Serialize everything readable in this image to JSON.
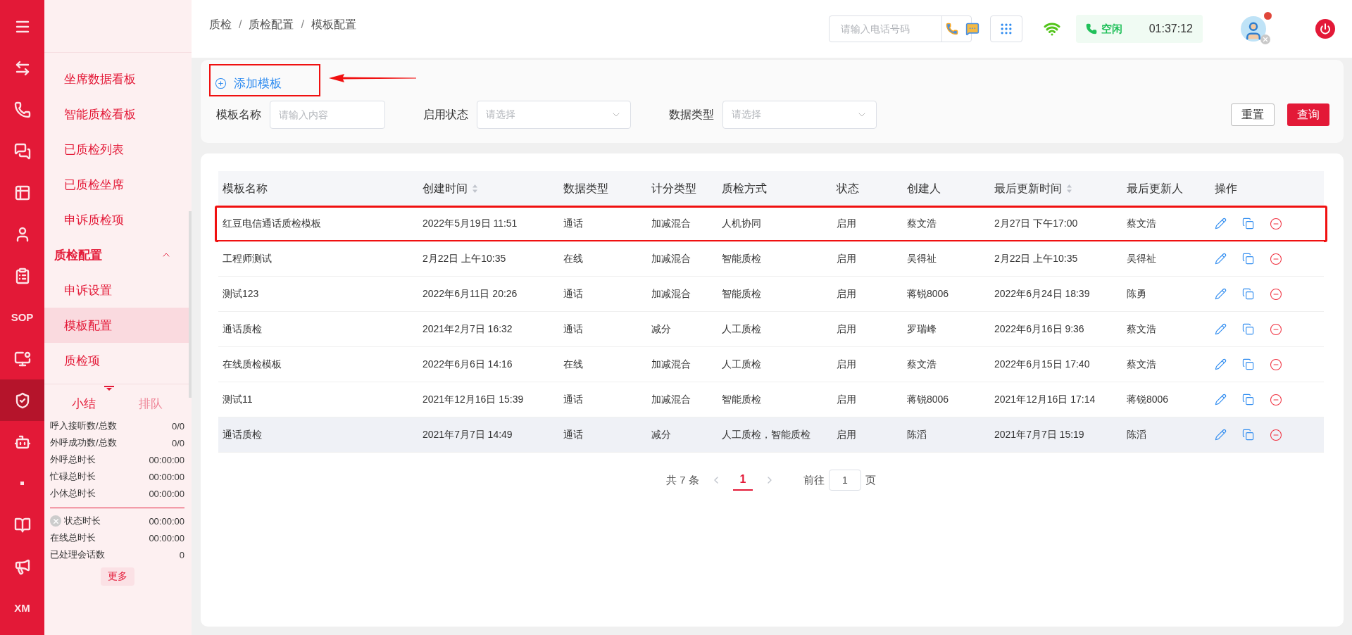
{
  "rail": [
    {
      "selected": false
    },
    {
      "selected": false
    },
    {
      "selected": false
    },
    {
      "selected": false
    },
    {
      "selected": false
    },
    {
      "selected": false
    },
    {
      "selected": false
    },
    {
      "label": "SOP",
      "selected": false
    },
    {
      "selected": false
    },
    {
      "selected": true
    },
    {
      "selected": false
    },
    {
      "selected": false
    },
    {
      "selected": false
    },
    {
      "selected": false
    },
    {
      "label": "XM",
      "selected": false
    }
  ],
  "submenu": [
    {
      "label": "坐席数据看板",
      "selected": false
    },
    {
      "label": "智能质检看板",
      "selected": false
    },
    {
      "label": "已质检列表",
      "selected": false
    },
    {
      "label": "已质检坐席",
      "selected": false
    },
    {
      "label": "申诉质检项",
      "selected": false
    },
    {
      "label": "质检配置",
      "expanded": true,
      "children": [
        {
          "label": "申诉设置",
          "selected": false
        },
        {
          "label": "模板配置",
          "selected": true
        },
        {
          "label": "质检项",
          "selected": false
        }
      ]
    }
  ],
  "stats": {
    "tabs": [
      {
        "label": "小结",
        "selected": true
      },
      {
        "label": "排队",
        "selected": false
      }
    ],
    "primary": [
      {
        "label": "呼入接听数/总数",
        "value": "0/0"
      },
      {
        "label": "外呼成功数/总数",
        "value": "0/0"
      },
      {
        "label": "外呼总时长",
        "value": "00:00:00"
      },
      {
        "label": "忙碌总时长",
        "value": "00:00:00"
      },
      {
        "label": "小休总时长",
        "value": "00:00:00"
      }
    ],
    "secondary": [
      {
        "label": "状态时长",
        "value": "00:00:00",
        "kind": "status"
      },
      {
        "label": "在线总时长",
        "value": "00:00:00",
        "kind": "plain"
      },
      {
        "label": "已处理会话数",
        "value": "0",
        "kind": "plain"
      }
    ],
    "more_button": "更多"
  },
  "breadcrumb": [
    "质检",
    "质检配置",
    "模板配置"
  ],
  "breadcrumb_separator": "/",
  "topbar": {
    "phone_placeholder": "请输入电话号码",
    "status": "空闲",
    "timer": "01:37:12"
  },
  "add_button": {
    "label": "添加模板",
    "annotated": true
  },
  "filters": [
    {
      "kind": "input",
      "label": "模板名称",
      "placeholder": "请输入内容"
    },
    {
      "kind": "select",
      "label": "启用状态",
      "placeholder": "请选择"
    },
    {
      "kind": "select",
      "label": "数据类型",
      "placeholder": "请选择"
    }
  ],
  "buttons": {
    "reset": "重置",
    "search": "查询"
  },
  "table": {
    "columns": [
      {
        "label": "模板名称"
      },
      {
        "label": "创建时间",
        "sortable": true
      },
      {
        "label": "数据类型"
      },
      {
        "label": "计分类型"
      },
      {
        "label": "质检方式"
      },
      {
        "label": "状态"
      },
      {
        "label": "创建人"
      },
      {
        "label": "最后更新时间",
        "sortable": true
      },
      {
        "label": "最后更新人"
      },
      {
        "label": "操作"
      }
    ],
    "rows": [
      {
        "cells": [
          "红豆电信通话质检模板",
          "2022年5月19日 11:51",
          "通话",
          "加减混合",
          "人机协同",
          "启用",
          "蔡文浩",
          "2月27日 下午17:00",
          "蔡文浩"
        ],
        "annotated": true,
        "hovered": false
      },
      {
        "cells": [
          "工程师测试",
          "2月22日 上午10:35",
          "在线",
          "加减混合",
          "智能质检",
          "启用",
          "吴得祉",
          "2月22日 上午10:35",
          "吴得祉"
        ],
        "annotated": false,
        "hovered": false
      },
      {
        "cells": [
          "测试123",
          "2022年6月11日 20:26",
          "通话",
          "加减混合",
          "智能质检",
          "启用",
          "蒋锐8006",
          "2022年6月24日 18:39",
          "陈勇"
        ],
        "annotated": false,
        "hovered": false
      },
      {
        "cells": [
          "通话质检",
          "2021年2月7日 16:32",
          "通话",
          "减分",
          "人工质检",
          "启用",
          "罗瑞峰",
          "2022年6月16日 9:36",
          "蔡文浩"
        ],
        "annotated": false,
        "hovered": false
      },
      {
        "cells": [
          "在线质检模板",
          "2022年6月6日 14:16",
          "在线",
          "加减混合",
          "人工质检",
          "启用",
          "蔡文浩",
          "2022年6月15日 17:40",
          "蔡文浩"
        ],
        "annotated": false,
        "hovered": false
      },
      {
        "cells": [
          "测试11",
          "2021年12月16日 15:39",
          "通话",
          "加减混合",
          "智能质检",
          "启用",
          "蒋锐8006",
          "2021年12月16日 17:14",
          "蒋锐8006"
        ],
        "annotated": false,
        "hovered": false
      },
      {
        "cells": [
          "通话质检",
          "2021年7月7日 14:49",
          "通话",
          "减分",
          "人工质检，智能质检",
          "启用",
          "陈滔",
          "2021年7月7日 15:19",
          "陈滔"
        ],
        "annotated": false,
        "hovered": true
      }
    ]
  },
  "pagination": {
    "total": "共 7 条",
    "pages": [
      {
        "label": "1",
        "selected": true
      }
    ],
    "goto_label": "前往",
    "goto_value": "1",
    "page_suffix": "页"
  }
}
